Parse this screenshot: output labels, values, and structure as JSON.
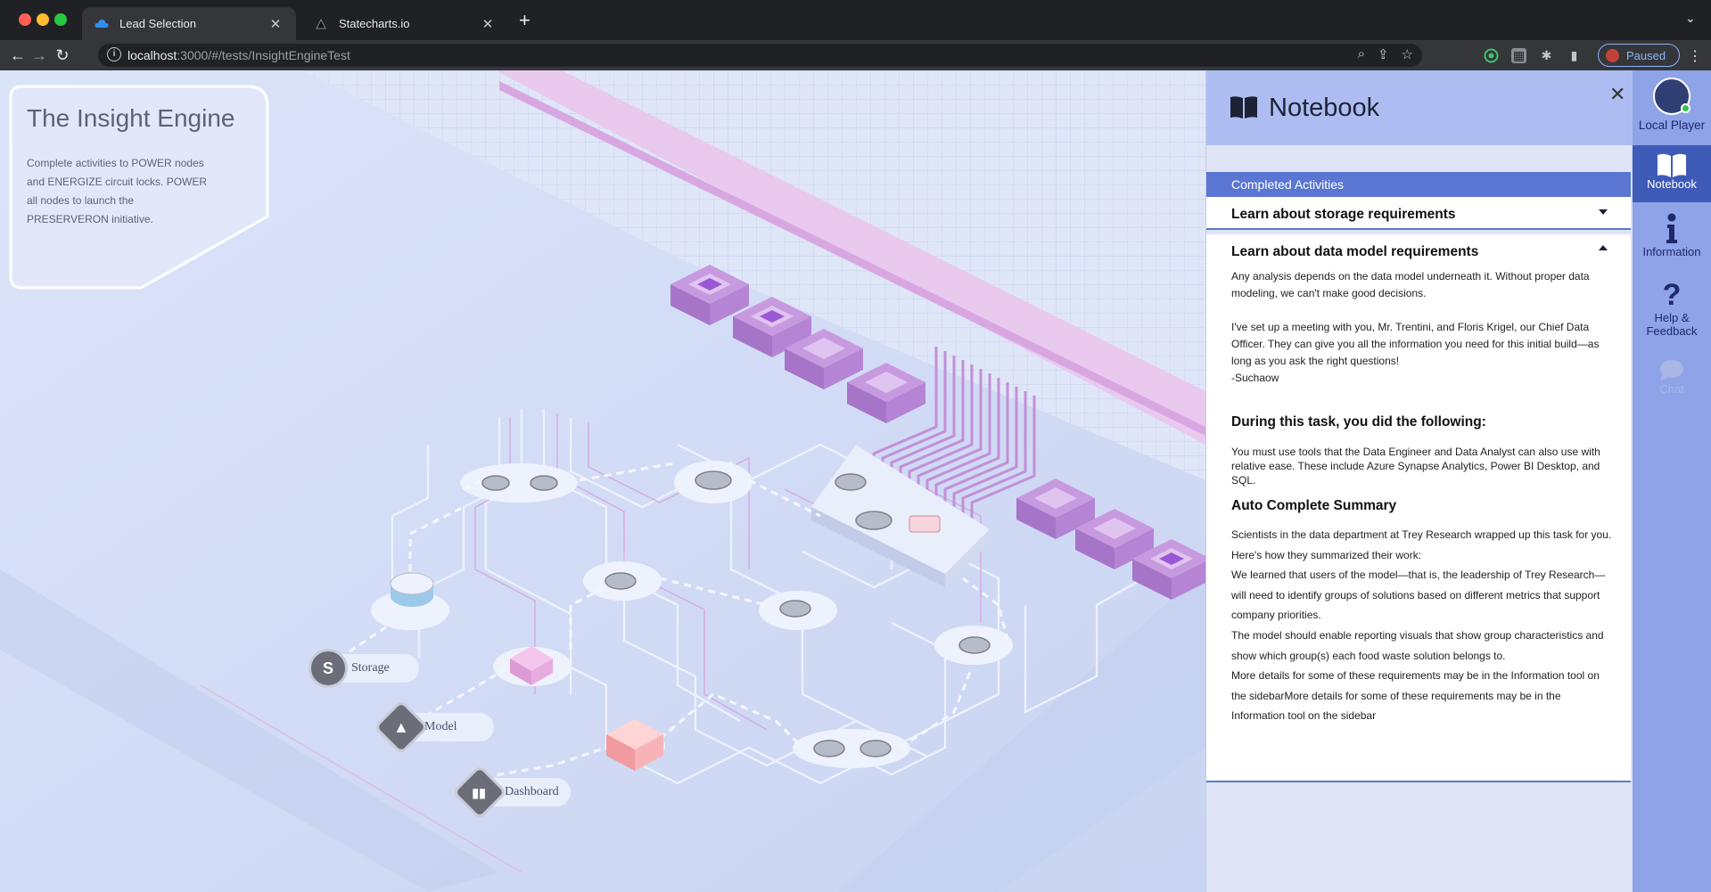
{
  "browser": {
    "tabs": [
      {
        "title": "Lead Selection",
        "icon": "cloud-icon",
        "active": true
      },
      {
        "title": "Statecharts.io",
        "icon": "statecharts-icon",
        "active": false
      }
    ],
    "url_host": "localhost",
    "url_path": ":3000/#/tests/InsightEngineTest",
    "profile_status": "Paused"
  },
  "game": {
    "title": "The Insight Engine",
    "description": "Complete activities to POWER nodes and ENERGIZE circuit locks. POWER all nodes to launch the PRESERVERON initiative.",
    "nodes": [
      {
        "label": "Storage",
        "icon": "storage-icon"
      },
      {
        "label": "Model",
        "icon": "model-icon"
      },
      {
        "label": "Dashboard",
        "icon": "dashboard-icon"
      }
    ]
  },
  "notebook": {
    "title": "Notebook",
    "section_label": "Completed Activities",
    "activities": [
      {
        "title": "Learn about storage requirements",
        "expanded": false
      },
      {
        "title": "Learn about data model requirements",
        "expanded": true,
        "message_p1": "Any analysis depends on the data model underneath it. Without proper data modeling, we can't make good decisions.",
        "message_p2": "I've set up a meeting with you, Mr. Trentini, and Floris Krigel, our Chief Data Officer. They can give you all the information you need for this initial build—as long as you ask the right questions!",
        "signature": "-Suchaow",
        "did_heading": "During this task, you did the following:",
        "did_text": "You must use tools that the Data Engineer and Data Analyst can also use with relative ease. These include Azure Synapse Analytics, Power BI Desktop, and SQL.",
        "summary_heading": "Auto Complete Summary",
        "summary_lines": [
          "Scientists in the data department at Trey Research wrapped up this task for you. Here's how they summarized their work:",
          "We learned that users of the model—that is, the leadership of Trey Research—will need to identify groups of solutions based on different metrics that support company priorities.",
          "The model should enable reporting visuals that show group characteristics and show which group(s) each food waste solution belongs to.",
          "More details for some of these requirements may be in the Information tool on the sidebarMore details for some of these requirements may be in the Information tool on the sidebar"
        ]
      }
    ]
  },
  "sidebar": {
    "player": "Local Player",
    "items": [
      {
        "label": "Notebook",
        "icon": "notebook-icon",
        "active": true
      },
      {
        "label": "Information",
        "icon": "info-icon",
        "active": false
      },
      {
        "label": "Help & Feedback",
        "icon": "help-icon",
        "active": false
      },
      {
        "label": "Chat",
        "icon": "chat-icon",
        "active": false,
        "disabled": true
      }
    ]
  },
  "colors": {
    "accent": "#5a76d2",
    "sidebar": "#8ea3e8",
    "sidebar_active": "#3f5bb8",
    "board": "#d3ddf7",
    "node_purple": "#b98ad8",
    "node_pink": "#f8b3b8"
  }
}
